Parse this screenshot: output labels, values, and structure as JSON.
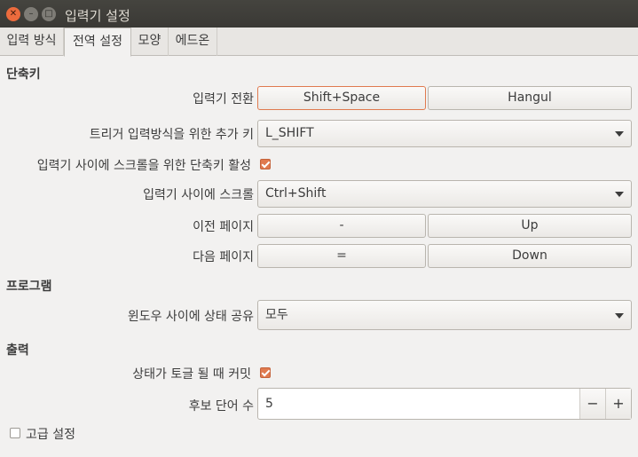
{
  "window": {
    "title": "입력기 설정",
    "close_glyph": "✕",
    "min_glyph": "–",
    "max_glyph": "□"
  },
  "tabs": [
    "입력 방식",
    "전역 설정",
    "모양",
    "에드온"
  ],
  "sections": {
    "shortcuts": "단축키",
    "program": "프로그램",
    "output": "출력"
  },
  "shortcuts": {
    "toggle_label": "입력기 전환",
    "toggle_values": [
      "Shift+Space",
      "Hangul"
    ],
    "trigger_label": "트리거 입력방식을 위한 추가 키",
    "trigger_value": "L_SHIFT",
    "enable_scroll_label": "입력기 사이에 스크롤을 위한 단축키 활성",
    "enable_scroll_checked": true,
    "scroll_label": "입력기 사이에 스크롤",
    "scroll_value": "Ctrl+Shift",
    "prev_page_label": "이전 페이지",
    "prev_page_values": [
      "-",
      "Up"
    ],
    "next_page_label": "다음 페이지",
    "next_page_values": [
      "=",
      "Down"
    ]
  },
  "program": {
    "share_label": "윈도우 사이에 상태 공유",
    "share_value": "모두"
  },
  "output": {
    "commit_label": "상태가 토글 될 때 커밋",
    "commit_checked": true,
    "candidates_label": "후보 단어 수",
    "candidates_value": "5",
    "minus": "−",
    "plus": "+"
  },
  "advanced": {
    "label": "고급 설정",
    "checked": false
  },
  "colors": {
    "accent": "#e07a4f",
    "titlebar": "#3c3b37",
    "background": "#f2f1f0"
  }
}
